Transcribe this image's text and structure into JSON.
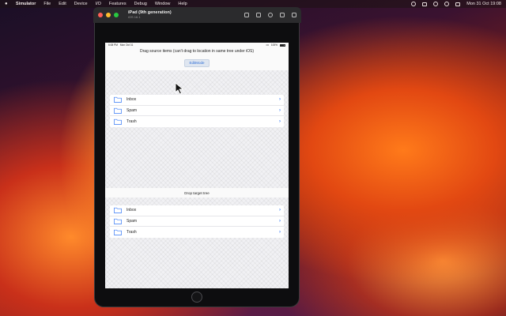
{
  "menubar": {
    "app_name": "Simulator",
    "items": [
      "File",
      "Edit",
      "Device",
      "I/O",
      "Features",
      "Debug",
      "Window",
      "Help"
    ],
    "clock": "Mon 31 Oct  19:08"
  },
  "simulator_window": {
    "title": "iPad (9th generation)",
    "subtitle": "iOS 16.1"
  },
  "ipad_statusbar": {
    "time": "6:08 PM",
    "date": "Mon Oct 31",
    "battery": "100%"
  },
  "source_section": {
    "title": "Drag source items (can't drag to location in same tree under iOS)",
    "edit_button_label": "EditMode",
    "rows": [
      {
        "label": "Inbox",
        "icon": "folder-icon"
      },
      {
        "label": "Spam",
        "icon": "folder-icon"
      },
      {
        "label": "Trash",
        "icon": "folder-icon"
      }
    ]
  },
  "target_section": {
    "title": "Drop target tree",
    "rows": [
      {
        "label": "Inbox",
        "icon": "folder-icon"
      },
      {
        "label": "Spam",
        "icon": "folder-icon"
      },
      {
        "label": "Trash",
        "icon": "folder-icon"
      }
    ]
  },
  "colors": {
    "accent": "#3478f6",
    "folder_stroke": "#3478f6",
    "edit_button_bg": "#dfe6f0"
  }
}
